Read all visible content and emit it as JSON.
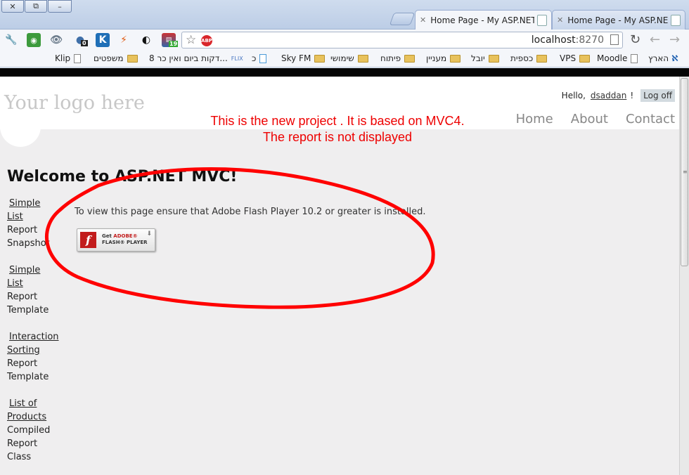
{
  "browser": {
    "window_controls": {
      "restore": "⧉",
      "minimize": "–"
    },
    "tabs": [
      {
        "title": "Home Page - My ASP.NET",
        "active": true
      },
      {
        "title": "Home Page - My ASP.NET",
        "active": false
      }
    ],
    "toolbar": {
      "url_host": "localhost",
      "url_port": ":8270",
      "abp_label": "ABP",
      "extension_badges": {
        "zero": "0",
        "nineteen": "19",
        "k": "K"
      }
    },
    "bookmarks": [
      "הארץ",
      "Moodle",
      "VPS",
      "כספית",
      "יובל",
      "מעניין",
      "פיתוח",
      "שימושי",
      "Sky FM",
      "כ",
      "8 דקות ביום ואין כר...",
      "משפטים",
      "Klip"
    ]
  },
  "page": {
    "logo": "Your logo here",
    "login": {
      "greeting": "Hello,",
      "username": "dsaddan",
      "suffix": "!",
      "logoff": "Log off"
    },
    "menu": [
      "Home",
      "About",
      "Contact"
    ],
    "annotation": "This is the new project . It is based on MVC4. The report is not displayed",
    "welcome": "Welcome to ASP.NET MVC!",
    "side_nav": [
      {
        "link": "Simple List",
        "text": [
          "Report",
          "Snapshot"
        ]
      },
      {
        "link": "Simple List",
        "text": [
          "Report",
          "Template"
        ]
      },
      {
        "link": "Interaction Sorting",
        "text": [
          "Report",
          "Template"
        ]
      },
      {
        "link": "List of Products",
        "text": [
          "Compiled",
          "Report",
          "Class"
        ]
      }
    ],
    "flash": {
      "message": "To view this page ensure that Adobe Flash Player 10.2 or greater is installed.",
      "badge_get": "Get",
      "badge_adobe": "ADOBE®",
      "badge_player": "FLASH® PLAYER"
    }
  },
  "colors": {
    "annotation_red": "#ee0000",
    "page_bg": "#efeeef",
    "chrome_blue": "#cfdcee"
  },
  "icons": [
    "wrench-icon",
    "ghostery-icon",
    "eye-icon",
    "cookie-icon",
    "k-icon",
    "lightning-icon",
    "contrast-icon",
    "bookmarks-ext-icon",
    "star-icon",
    "abp-icon",
    "page-icon",
    "reload-icon",
    "back-icon",
    "forward-icon",
    "folder-icon",
    "flash-icon"
  ]
}
